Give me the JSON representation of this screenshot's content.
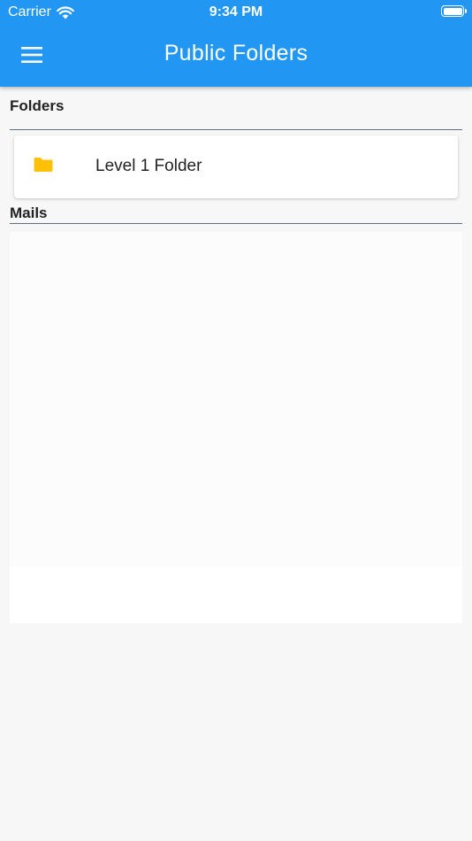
{
  "status_bar": {
    "carrier": "Carrier",
    "time": "9:34 PM",
    "icons": [
      "wifi-icon",
      "battery-icon"
    ]
  },
  "app_bar": {
    "title": "Public Folders",
    "menu_icon": "menu-icon",
    "background_color": "#2196f3"
  },
  "sections": {
    "folders": {
      "title": "Folders",
      "items": [
        {
          "label": "Level 1 Folder",
          "icon": "folder-icon",
          "icon_color": "#ffc107"
        }
      ]
    },
    "mails": {
      "title": "Mails",
      "items": []
    }
  }
}
